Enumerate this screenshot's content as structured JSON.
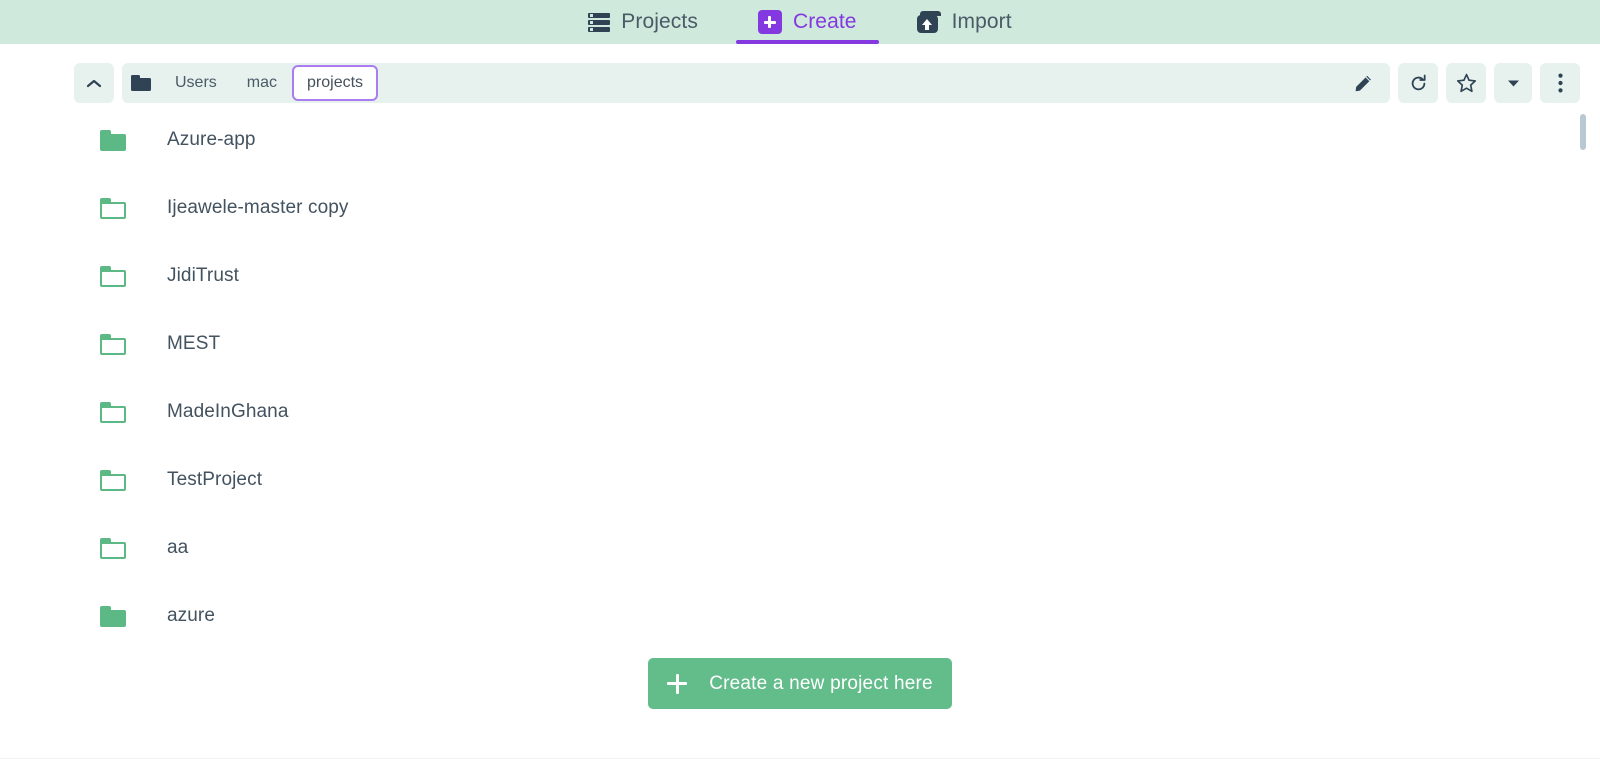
{
  "header": {
    "background_color": "#cfe9dc",
    "accent_color": "#8338e0",
    "tabs": [
      {
        "label": "Projects",
        "icon": "list-icon",
        "active": false
      },
      {
        "label": "Create",
        "icon": "plus-square-icon",
        "active": true
      },
      {
        "label": "Import",
        "icon": "import-box-icon",
        "active": false
      }
    ]
  },
  "toolbar": {
    "background_color": "#e7f2ee",
    "up_button_icon": "chevron-up-icon",
    "root_folder_icon": "folder-filled-icon",
    "breadcrumbs": [
      {
        "label": "Users",
        "current": false
      },
      {
        "label": "mac",
        "current": false
      },
      {
        "label": "projects",
        "current": true
      }
    ],
    "current_crumb_border_color": "#a97df0",
    "edit_icon": "pencil-icon",
    "refresh_icon": "refresh-icon",
    "favorite_icon": "star-icon",
    "favorite_dropdown_icon": "caret-down-icon",
    "more_icon": "more-vertical-icon"
  },
  "file_list": {
    "folder_color": "#5cb985",
    "items": [
      {
        "name": "Azure-app",
        "icon": "folder-filled-icon",
        "style": "filled"
      },
      {
        "name": "Ijeawele-master copy",
        "icon": "folder-outline-icon",
        "style": "outline"
      },
      {
        "name": "JidiTrust",
        "icon": "folder-outline-icon",
        "style": "outline"
      },
      {
        "name": "MEST",
        "icon": "folder-outline-icon",
        "style": "outline"
      },
      {
        "name": "MadeInGhana",
        "icon": "folder-outline-icon",
        "style": "outline"
      },
      {
        "name": "TestProject",
        "icon": "folder-outline-icon",
        "style": "outline"
      },
      {
        "name": "aa",
        "icon": "folder-outline-icon",
        "style": "outline"
      },
      {
        "name": "azure",
        "icon": "folder-filled-icon",
        "style": "filled"
      }
    ],
    "scrollbar": {
      "visible": true,
      "thumb_color": "#b9c9d4"
    }
  },
  "footer": {
    "create_label": "Create a new project here",
    "create_icon": "plus-icon",
    "create_color": "#63bd8b"
  }
}
